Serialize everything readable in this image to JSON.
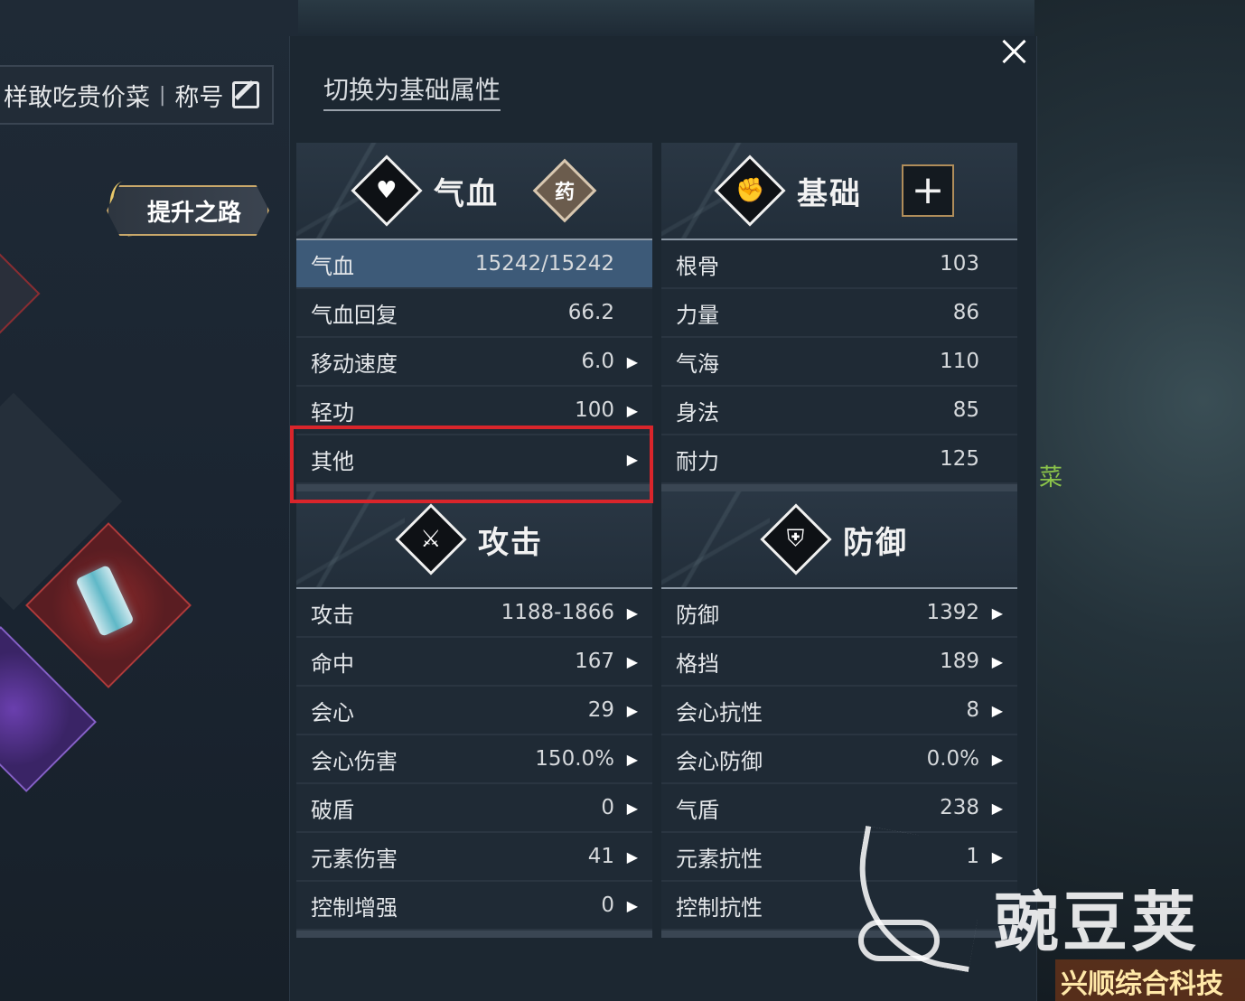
{
  "header": {
    "player_name": "样敢吃贵价菜",
    "separator": "|",
    "title_label": "称号",
    "switch_link": "切换为基础属性"
  },
  "promo": {
    "label": "提升之路"
  },
  "sections": {
    "qixue": {
      "title": "气血",
      "badge": "药",
      "rows": [
        {
          "label": "气血",
          "value": "15242/15242",
          "arrow": false
        },
        {
          "label": "气血回复",
          "value": "66.2",
          "arrow": false
        },
        {
          "label": "移动速度",
          "value": "6.0",
          "arrow": true
        },
        {
          "label": "轻功",
          "value": "100",
          "arrow": true
        },
        {
          "label": "其他",
          "value": "",
          "arrow": true
        }
      ]
    },
    "jichu": {
      "title": "基础",
      "plus": "+",
      "rows": [
        {
          "label": "根骨",
          "value": "103",
          "arrow": false
        },
        {
          "label": "力量",
          "value": "86",
          "arrow": false
        },
        {
          "label": "气海",
          "value": "110",
          "arrow": false
        },
        {
          "label": "身法",
          "value": "85",
          "arrow": false
        },
        {
          "label": "耐力",
          "value": "125",
          "arrow": false
        }
      ]
    },
    "gongji": {
      "title": "攻击",
      "rows": [
        {
          "label": "攻击",
          "value": "1188-1866",
          "arrow": true
        },
        {
          "label": "命中",
          "value": "167",
          "arrow": true
        },
        {
          "label": "会心",
          "value": "29",
          "arrow": true
        },
        {
          "label": "会心伤害",
          "value": "150.0%",
          "arrow": true
        },
        {
          "label": "破盾",
          "value": "0",
          "arrow": true
        },
        {
          "label": "元素伤害",
          "value": "41",
          "arrow": true
        },
        {
          "label": "控制增强",
          "value": "0",
          "arrow": true
        }
      ]
    },
    "fangyu": {
      "title": "防御",
      "rows": [
        {
          "label": "防御",
          "value": "1392",
          "arrow": true
        },
        {
          "label": "格挡",
          "value": "189",
          "arrow": true
        },
        {
          "label": "会心抗性",
          "value": "8",
          "arrow": true
        },
        {
          "label": "会心防御",
          "value": "0.0%",
          "arrow": true
        },
        {
          "label": "气盾",
          "value": "238",
          "arrow": true
        },
        {
          "label": "元素抗性",
          "value": "1",
          "arrow": true
        },
        {
          "label": "控制抗性",
          "value": "",
          "arrow": false
        }
      ]
    }
  },
  "side_text": "菜",
  "watermark": "豌豆荚",
  "site_tag": "兴顺综合科技网",
  "colors": {
    "highlight_row": "#3d5a78",
    "selection_box": "#d9252b",
    "panel_bg": "#1c2731"
  },
  "icons": {
    "qixue": "heart-icon",
    "jichu": "fist-icon",
    "gongji": "crossed-swords-icon",
    "fangyu": "shield-icon"
  }
}
